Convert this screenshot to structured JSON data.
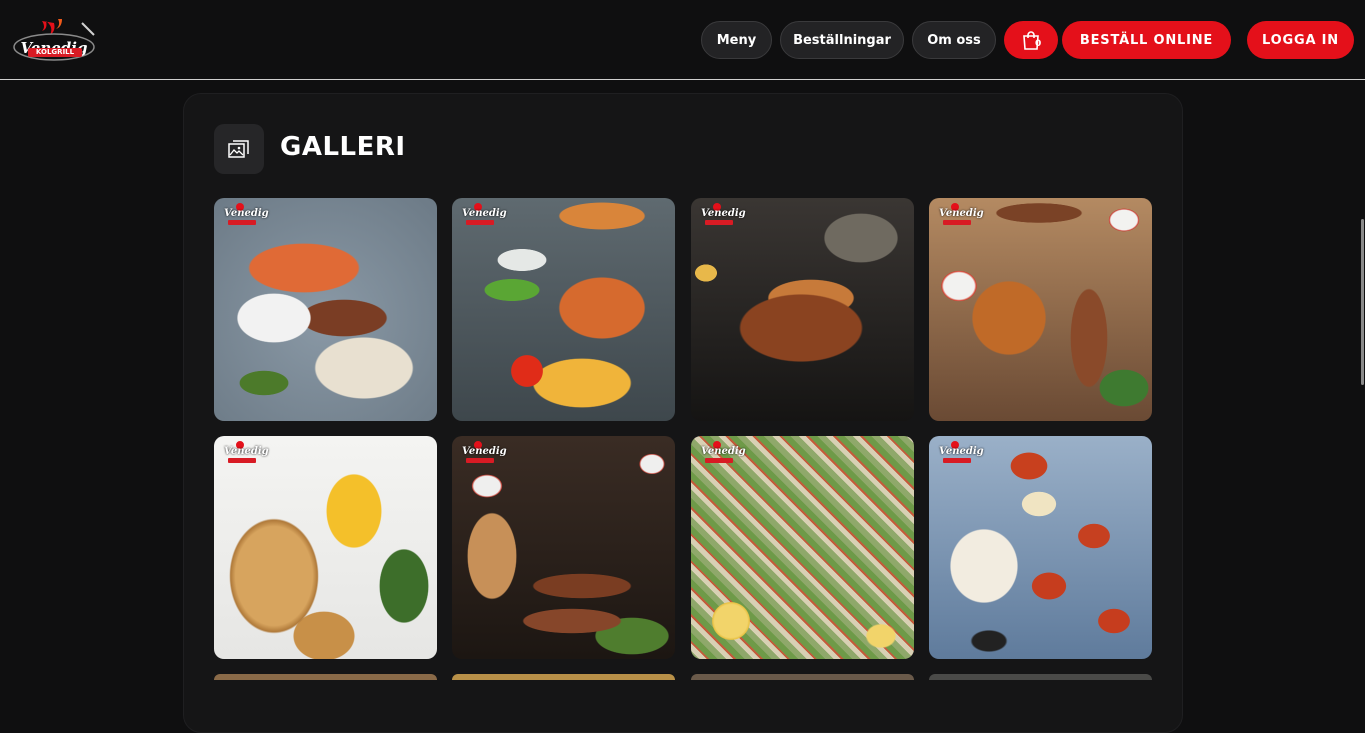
{
  "brand": {
    "name": "Venedig",
    "sub": "KOLGRILL"
  },
  "nav": {
    "menu": "Meny",
    "orders": "Beställningar",
    "about": "Om oss",
    "cart_count": "0",
    "order_online": "BESTÄLL ONLINE",
    "login": "LOGGA IN"
  },
  "gallery": {
    "title": "GALLERI",
    "items": [
      {
        "desc": "kebab-rice-platter"
      },
      {
        "desc": "chicken-fries-plate"
      },
      {
        "desc": "grilled-wrap-platter"
      },
      {
        "desc": "mixed-grill-skewers"
      },
      {
        "desc": "pide-with-fries"
      },
      {
        "desc": "kebab-flatbread"
      },
      {
        "desc": "salad-tray"
      },
      {
        "desc": "rice-with-sauce-pieces"
      }
    ]
  },
  "colors": {
    "accent": "#e4101a",
    "background": "#0f0f10",
    "card": "#151516"
  }
}
